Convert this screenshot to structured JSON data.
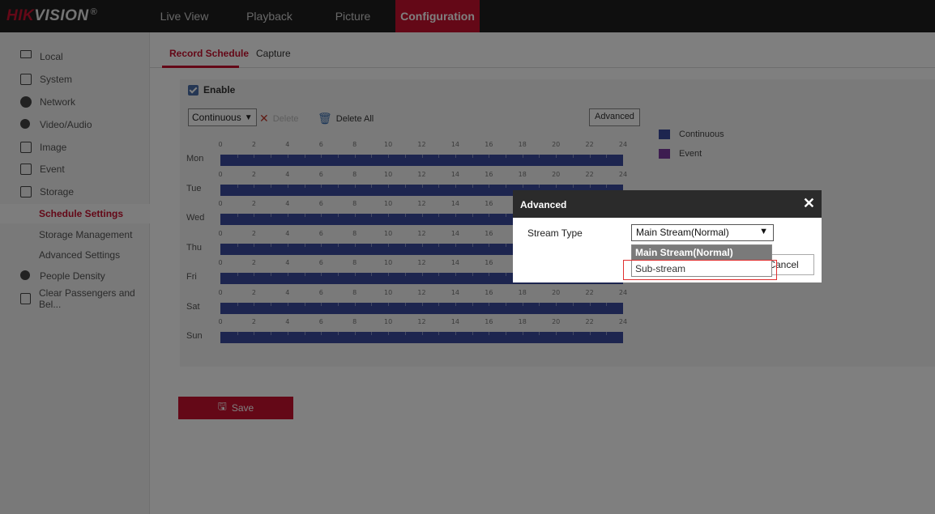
{
  "brand": {
    "prefix": "HIK",
    "rest": "VISION",
    "mark": "®"
  },
  "nav": [
    {
      "label": "Live View",
      "active": false
    },
    {
      "label": "Playback",
      "active": false
    },
    {
      "label": "Picture",
      "active": false
    },
    {
      "label": "Configuration",
      "active": true
    }
  ],
  "sidebar": {
    "items": [
      {
        "label": "Local",
        "icon": "monitor-icon"
      },
      {
        "label": "System",
        "icon": "system-icon"
      },
      {
        "label": "Network",
        "icon": "globe-icon"
      },
      {
        "label": "Video/Audio",
        "icon": "video-audio-icon"
      },
      {
        "label": "Image",
        "icon": "image-icon"
      },
      {
        "label": "Event",
        "icon": "calendar-icon"
      },
      {
        "label": "Storage",
        "icon": "storage-icon"
      }
    ],
    "sub_items": [
      {
        "label": "Schedule Settings",
        "active": true
      },
      {
        "label": "Storage Management",
        "active": false
      },
      {
        "label": "Advanced Settings",
        "active": false
      }
    ],
    "extra_items": [
      {
        "label": "People Density",
        "icon": "people-icon"
      },
      {
        "label": "Clear Passengers and Bel...",
        "icon": "passenger-icon"
      }
    ]
  },
  "tabs": [
    {
      "label": "Record Schedule",
      "active": true
    },
    {
      "label": "Capture",
      "active": false
    }
  ],
  "schedule": {
    "enable_label": "Enable",
    "enabled": true,
    "mode_value": "Continuous",
    "delete_label": "Delete",
    "delete_all_label": "Delete All",
    "advanced_label": "Advanced",
    "days": [
      "Mon",
      "Tue",
      "Wed",
      "Thu",
      "Fri",
      "Sat",
      "Sun"
    ],
    "hours": [
      "0",
      "2",
      "4",
      "6",
      "8",
      "10",
      "12",
      "14",
      "16",
      "18",
      "20",
      "22",
      "24"
    ],
    "legend": [
      {
        "label": "Continuous",
        "color": "#3a4a9e"
      },
      {
        "label": "Event",
        "color": "#7a3aa0"
      }
    ],
    "save_label": "Save"
  },
  "dialog": {
    "title": "Advanced",
    "stream_type_label": "Stream Type",
    "stream_type_value": "Main Stream(Normal)",
    "options": [
      {
        "label": "Main Stream(Normal)",
        "selected": true
      },
      {
        "label": "Sub-stream",
        "selected": false
      }
    ],
    "cancel_label": "Cancel"
  },
  "colors": {
    "accent": "#c8102e",
    "bar": "#3a4a9e"
  }
}
